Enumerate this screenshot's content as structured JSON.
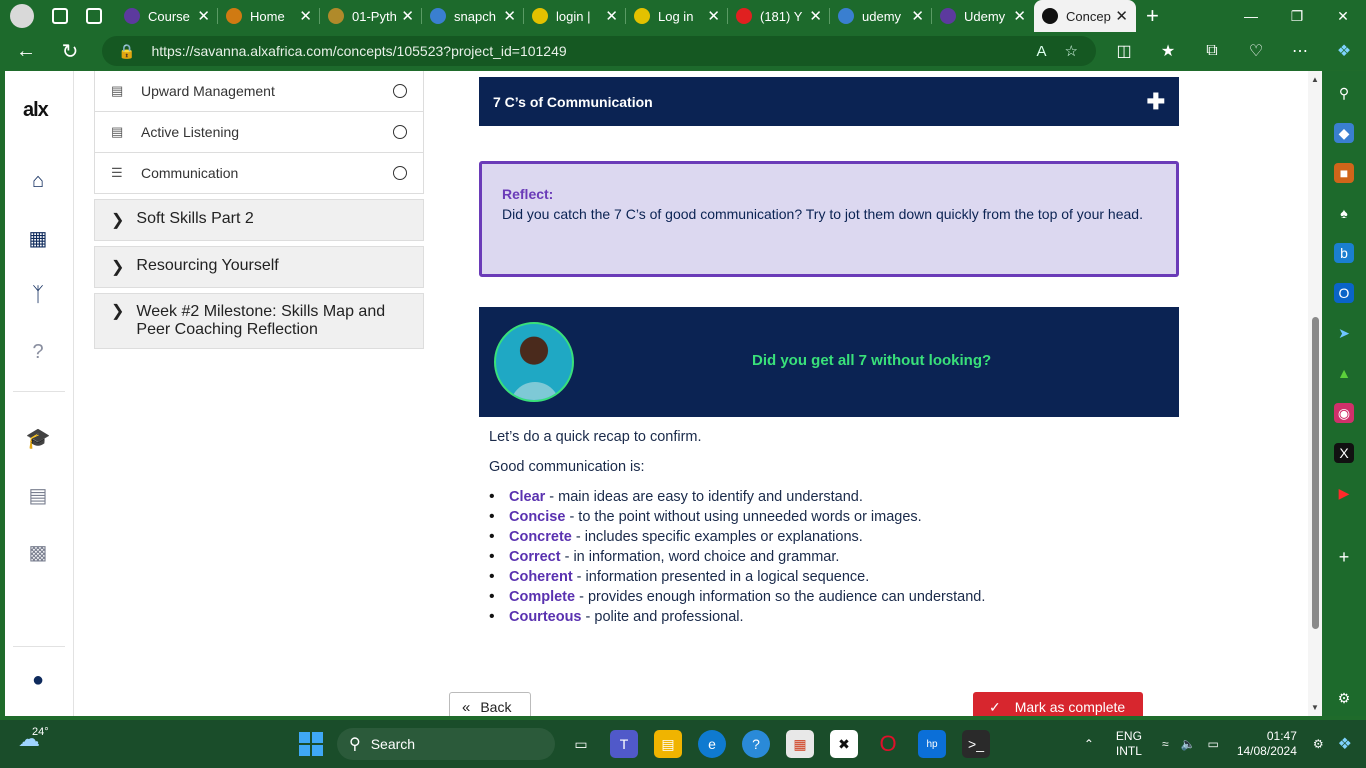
{
  "browser": {
    "tabs": [
      {
        "title": "Course",
        "color": "#5c3a9e"
      },
      {
        "title": "Home",
        "color": "#d07a12"
      },
      {
        "title": "01-Pyth",
        "color": "#b08a2a"
      },
      {
        "title": "snapch",
        "color": "#3a7fd0"
      },
      {
        "title": "login |",
        "color": "#e3c100"
      },
      {
        "title": "Log in",
        "color": "#e3c100"
      },
      {
        "title": "(181) Y",
        "color": "#e02020"
      },
      {
        "title": "udemy",
        "color": "#3a7fd0"
      },
      {
        "title": "Udemy",
        "color": "#5c3a9e"
      },
      {
        "title": "Concep",
        "color": "#111111"
      }
    ],
    "url": "https://savanna.alxafrica.com/concepts/105523?project_id=101249"
  },
  "leftnav": {
    "logo": "alx"
  },
  "sidebar": {
    "items": [
      {
        "label": "Upward Management",
        "icon": "document-icon"
      },
      {
        "label": "Active Listening",
        "icon": "document-icon"
      },
      {
        "label": "Communication",
        "icon": "checklist-icon"
      }
    ],
    "sections": [
      {
        "label": "Soft Skills Part 2"
      },
      {
        "label": "Resourcing Yourself"
      },
      {
        "label": "Week #2 Milestone: Skills Map and Peer Coaching Reflection"
      }
    ]
  },
  "main": {
    "accordion_title": "7 C’s of Communication",
    "reflect_heading": "Reflect:",
    "reflect_text": "Did you catch the 7 C’s of good communication? Try to jot them down quickly from the top of your head.",
    "quiz_text": "Did you get all 7 without looking?",
    "intro": "Let’s do a quick recap to confirm.",
    "lead": "Good communication is:",
    "list": [
      {
        "term": "Clear",
        "desc": " - main ideas are easy to identify and understand."
      },
      {
        "term": "Concise",
        "desc": " - to the point without using unneeded words or images."
      },
      {
        "term": "Concrete",
        "desc": " - includes specific examples or explanations."
      },
      {
        "term": "Correct",
        "desc": " - in information, word choice and grammar."
      },
      {
        "term": "Coherent",
        "desc": " - information presented in a logical sequence."
      },
      {
        "term": "Complete",
        "desc": " - provides enough information so the audience can understand."
      },
      {
        "term": "Courteous",
        "desc": " - polite and professional."
      }
    ],
    "back_label": "Back",
    "mark_label": "Mark as complete"
  },
  "taskbar": {
    "temperature": "24°",
    "search_placeholder": "Search",
    "lang_top": "ENG",
    "lang_bottom": "INTL",
    "time": "01:47",
    "date": "14/08/2024"
  },
  "colors": {
    "navy": "#0b2353",
    "accent_purple": "#6a3bb8",
    "quiz_green": "#39e07a",
    "mark_red": "#d7262e",
    "chrome_green": "#1d6a2c"
  }
}
